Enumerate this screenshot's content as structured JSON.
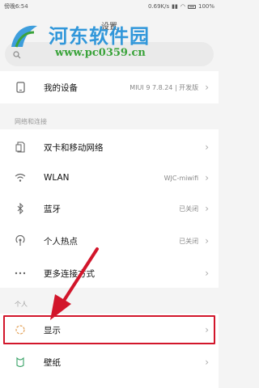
{
  "status_bar": {
    "time": "傍晚6:54",
    "speed": "0.69K/s",
    "battery": "100%"
  },
  "header": {
    "title": "设置"
  },
  "search": {
    "placeholder": ""
  },
  "watermark": {
    "title": "河东软件园",
    "url": "www.pc0359.cn"
  },
  "device": {
    "label": "我的设备",
    "value": "MIUI 9 7.8.24 | 开发版"
  },
  "network_section": {
    "label": "网络和连接",
    "items": [
      {
        "label": "双卡和移动网络",
        "value": ""
      },
      {
        "label": "WLAN",
        "value": "WJC-miwifi"
      },
      {
        "label": "蓝牙",
        "value": "已关闭"
      },
      {
        "label": "个人热点",
        "value": "已关闭"
      },
      {
        "label": "更多连接方式",
        "value": ""
      }
    ]
  },
  "personal_section": {
    "label": "个人",
    "items": [
      {
        "label": "显示",
        "value": ""
      },
      {
        "label": "壁纸",
        "value": ""
      }
    ]
  },
  "colors": {
    "highlight": "#d2162b",
    "watermark_blue": "#1d8ed8",
    "watermark_green": "#3aa33a"
  }
}
